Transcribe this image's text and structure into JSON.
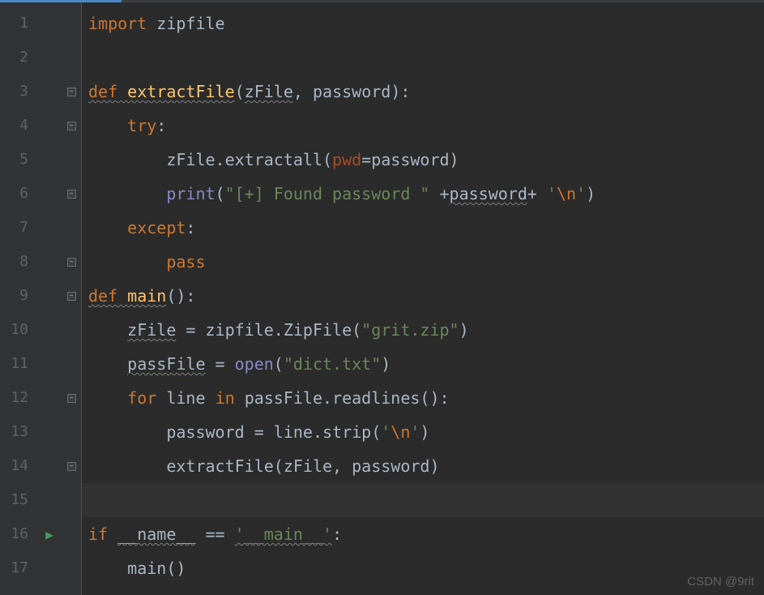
{
  "watermark": "CSDN @9rit",
  "run_line": 16,
  "current_line": 15,
  "line_count": 17,
  "code": {
    "l1": [
      {
        "cls": "kw",
        "t": "import "
      },
      {
        "cls": "ident",
        "t": "zipfile"
      }
    ],
    "l2": [],
    "l3": [
      {
        "cls": "kw wavy",
        "t": "def "
      },
      {
        "cls": "fn wavy",
        "t": "extractFile"
      },
      {
        "cls": "punct",
        "t": "("
      },
      {
        "cls": "ident wavy",
        "t": "zFile"
      },
      {
        "cls": "punct",
        "t": ", "
      },
      {
        "cls": "ident",
        "t": "password"
      },
      {
        "cls": "punct",
        "t": "):"
      }
    ],
    "l4": [
      {
        "cls": "",
        "t": "    "
      },
      {
        "cls": "kw",
        "t": "try"
      },
      {
        "cls": "punct",
        "t": ":"
      }
    ],
    "l5": [
      {
        "cls": "",
        "t": "        "
      },
      {
        "cls": "ident",
        "t": "zFile.extractall("
      },
      {
        "cls": "param",
        "t": "pwd"
      },
      {
        "cls": "punct",
        "t": "=password)"
      }
    ],
    "l6": [
      {
        "cls": "",
        "t": "        "
      },
      {
        "cls": "builtin",
        "t": "print"
      },
      {
        "cls": "punct",
        "t": "("
      },
      {
        "cls": "str",
        "t": "\"[+] Found password \" "
      },
      {
        "cls": "punct",
        "t": "+"
      },
      {
        "cls": "ident wavy",
        "t": "password"
      },
      {
        "cls": "punct",
        "t": "+ "
      },
      {
        "cls": "str",
        "t": "'"
      },
      {
        "cls": "esc",
        "t": "\\n"
      },
      {
        "cls": "str",
        "t": "'"
      },
      {
        "cls": "punct",
        "t": ")"
      }
    ],
    "l7": [
      {
        "cls": "",
        "t": "    "
      },
      {
        "cls": "kw",
        "t": "except"
      },
      {
        "cls": "punct",
        "t": ":"
      }
    ],
    "l8": [
      {
        "cls": "",
        "t": "        "
      },
      {
        "cls": "kw",
        "t": "pass"
      }
    ],
    "l9": [
      {
        "cls": "kw wavy",
        "t": "def "
      },
      {
        "cls": "fn wavy",
        "t": "main"
      },
      {
        "cls": "punct",
        "t": "():"
      }
    ],
    "l10": [
      {
        "cls": "",
        "t": "    "
      },
      {
        "cls": "ident wavy",
        "t": "zFile"
      },
      {
        "cls": "punct",
        "t": " = zipfile.ZipFile("
      },
      {
        "cls": "str",
        "t": "\"grit.zip\""
      },
      {
        "cls": "punct",
        "t": ")"
      }
    ],
    "l11": [
      {
        "cls": "",
        "t": "    "
      },
      {
        "cls": "ident wavy",
        "t": "passFile"
      },
      {
        "cls": "punct",
        "t": " = "
      },
      {
        "cls": "builtin",
        "t": "open"
      },
      {
        "cls": "punct",
        "t": "("
      },
      {
        "cls": "str",
        "t": "\"dict.txt\""
      },
      {
        "cls": "punct",
        "t": ")"
      }
    ],
    "l12": [
      {
        "cls": "",
        "t": "    "
      },
      {
        "cls": "kw",
        "t": "for "
      },
      {
        "cls": "ident",
        "t": "line "
      },
      {
        "cls": "kw",
        "t": "in "
      },
      {
        "cls": "ident",
        "t": "passFile.readlines():"
      }
    ],
    "l13": [
      {
        "cls": "",
        "t": "        "
      },
      {
        "cls": "ident",
        "t": "password = line.strip("
      },
      {
        "cls": "str",
        "t": "'"
      },
      {
        "cls": "esc",
        "t": "\\n"
      },
      {
        "cls": "str",
        "t": "'"
      },
      {
        "cls": "punct",
        "t": ")"
      }
    ],
    "l14": [
      {
        "cls": "",
        "t": "        "
      },
      {
        "cls": "ident",
        "t": "extractFile(zFile"
      },
      {
        "cls": "punct",
        "t": ", "
      },
      {
        "cls": "ident",
        "t": "password)"
      }
    ],
    "l15": [],
    "l16": [
      {
        "cls": "kw",
        "t": "if "
      },
      {
        "cls": "ident wavy",
        "t": "__name__"
      },
      {
        "cls": "punct",
        "t": " == "
      },
      {
        "cls": "str wavy",
        "t": "'__main__'"
      },
      {
        "cls": "punct",
        "t": ":"
      }
    ],
    "l17": [
      {
        "cls": "",
        "t": "    "
      },
      {
        "cls": "ident",
        "t": "main()"
      }
    ]
  },
  "fold_marks": {
    "3": "down",
    "4": "down",
    "6": "up",
    "8": "up",
    "9": "down",
    "12": "down",
    "14": "up"
  }
}
